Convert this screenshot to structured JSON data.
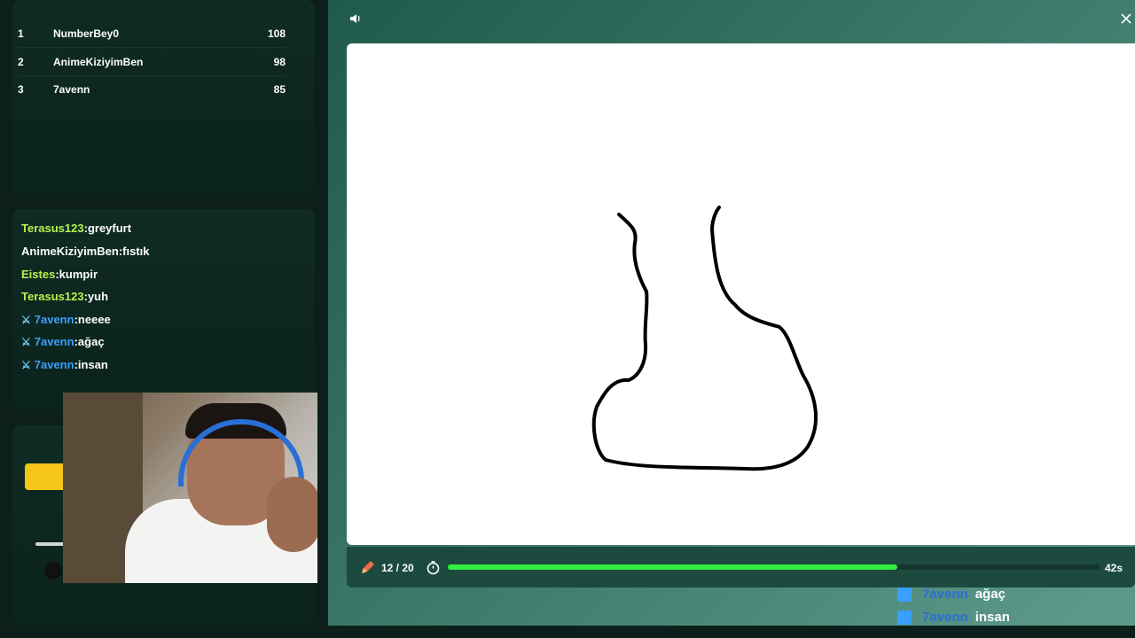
{
  "leaderboard": [
    {
      "rank": "1",
      "name": "NumberBey0",
      "score": "108"
    },
    {
      "rank": "2",
      "name": "AnimeKiziyimBen",
      "score": "98"
    },
    {
      "rank": "3",
      "name": "7avenn",
      "score": "85"
    }
  ],
  "chat": [
    {
      "user": "Terasus123",
      "msg": "greyfurt",
      "style": "green",
      "badge": false
    },
    {
      "user": "AnimeKiziyimBen",
      "msg": "fıstık",
      "style": "white",
      "badge": false
    },
    {
      "user": "Eistes",
      "msg": "kumpir",
      "style": "green",
      "badge": false
    },
    {
      "user": "Terasus123",
      "msg": "yuh",
      "style": "green",
      "badge": false
    },
    {
      "user": "7avenn",
      "msg": "neeee",
      "style": "blue",
      "badge": true
    },
    {
      "user": "7avenn",
      "msg": "ağaç",
      "style": "blue",
      "badge": true
    },
    {
      "user": "7avenn",
      "msg": "insan",
      "style": "blue",
      "badge": true
    }
  ],
  "status": {
    "round": "12 / 20",
    "timer": "42s",
    "progress_fraction": 0.69
  },
  "overlay_chat": [
    {
      "user": "7avenn",
      "msg": "ağaç"
    },
    {
      "user": "7avenn",
      "msg": "insan"
    }
  ],
  "icons": {
    "sound": "speaker-icon",
    "close": "close-icon",
    "pencil": "pencil-icon",
    "stopwatch": "stopwatch-icon"
  },
  "colors": {
    "progress": "#2ff03f",
    "yellow_button": "#f5c518",
    "username_blue": "#3aa0ff",
    "username_green": "#b6f24e"
  }
}
